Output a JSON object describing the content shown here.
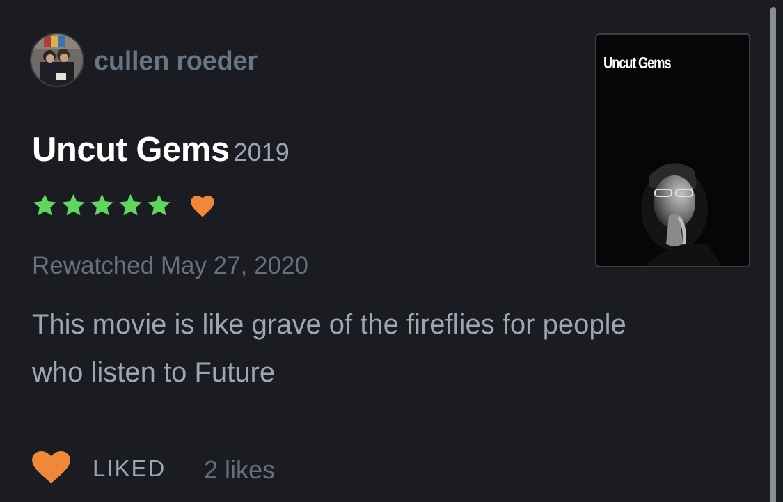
{
  "author": {
    "name": "cullen roeder",
    "avatar_icon": "user-avatar-photo"
  },
  "film": {
    "title": "Uncut Gems",
    "year": "2019",
    "poster_title": "Uncut Gems"
  },
  "rating": {
    "stars": 5,
    "max_stars": 5,
    "star_color": "#5fd75f",
    "liked_heart_color": "#f0883a"
  },
  "watched": {
    "text": "Rewatched May 27, 2020"
  },
  "review": {
    "text": "This movie is like grave of the fireflies for people who listen to Future"
  },
  "footer": {
    "like_icon": "heart-icon",
    "liked_label": "LIKED",
    "likes_count": "2 likes"
  }
}
